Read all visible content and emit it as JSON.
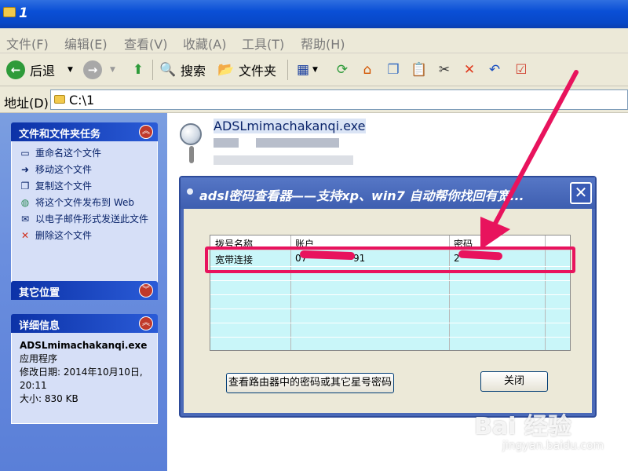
{
  "window": {
    "title": "1"
  },
  "menu": [
    "文件(F)",
    "编辑(E)",
    "查看(V)",
    "收藏(A)",
    "工具(T)",
    "帮助(H)"
  ],
  "toolbar": {
    "back_label": "后退",
    "search_label": "搜索",
    "folders_label": "文件夹"
  },
  "address": {
    "label": "地址(D)",
    "path": "C:\\1"
  },
  "left_pane": {
    "tasks_title": "文件和文件夹任务",
    "tasks": [
      {
        "label": "重命名这个文件",
        "icon": "rename-icon"
      },
      {
        "label": "移动这个文件",
        "icon": "move-icon"
      },
      {
        "label": "复制这个文件",
        "icon": "copy-icon"
      },
      {
        "label": "将这个文件发布到 Web",
        "icon": "web-icon"
      },
      {
        "label": "以电子邮件形式发送此文件",
        "icon": "email-icon"
      },
      {
        "label": "删除这个文件",
        "icon": "delete-icon"
      }
    ],
    "other_title": "其它位置",
    "details_title": "详细信息",
    "details": {
      "filename": "ADSLmimachakanqi.exe",
      "type": "应用程序",
      "modified": "修改日期: 2014年10月10日, 20:11",
      "size": "大小: 830 KB"
    }
  },
  "file": {
    "name": "ADSLmimachakanqi.exe"
  },
  "dialog": {
    "title": "adsl密码查看器——支持xp、win7 自动帮你找回有宽...",
    "columns": [
      "拨号名称",
      "账户",
      "密码"
    ],
    "rows": [
      {
        "name": "宽带连接",
        "account": "07",
        "account_tail": "91",
        "password": "2"
      }
    ],
    "router_button": "查看路由器中的密码或其它星号密码",
    "close_button": "关闭"
  },
  "watermark": {
    "brand": "Bai 经验",
    "url": "jingyan.baidu.com"
  },
  "colors": {
    "accent": "#e8135d",
    "title_blue": "#0a4fd6",
    "grid_bg": "#c9f6f9"
  }
}
